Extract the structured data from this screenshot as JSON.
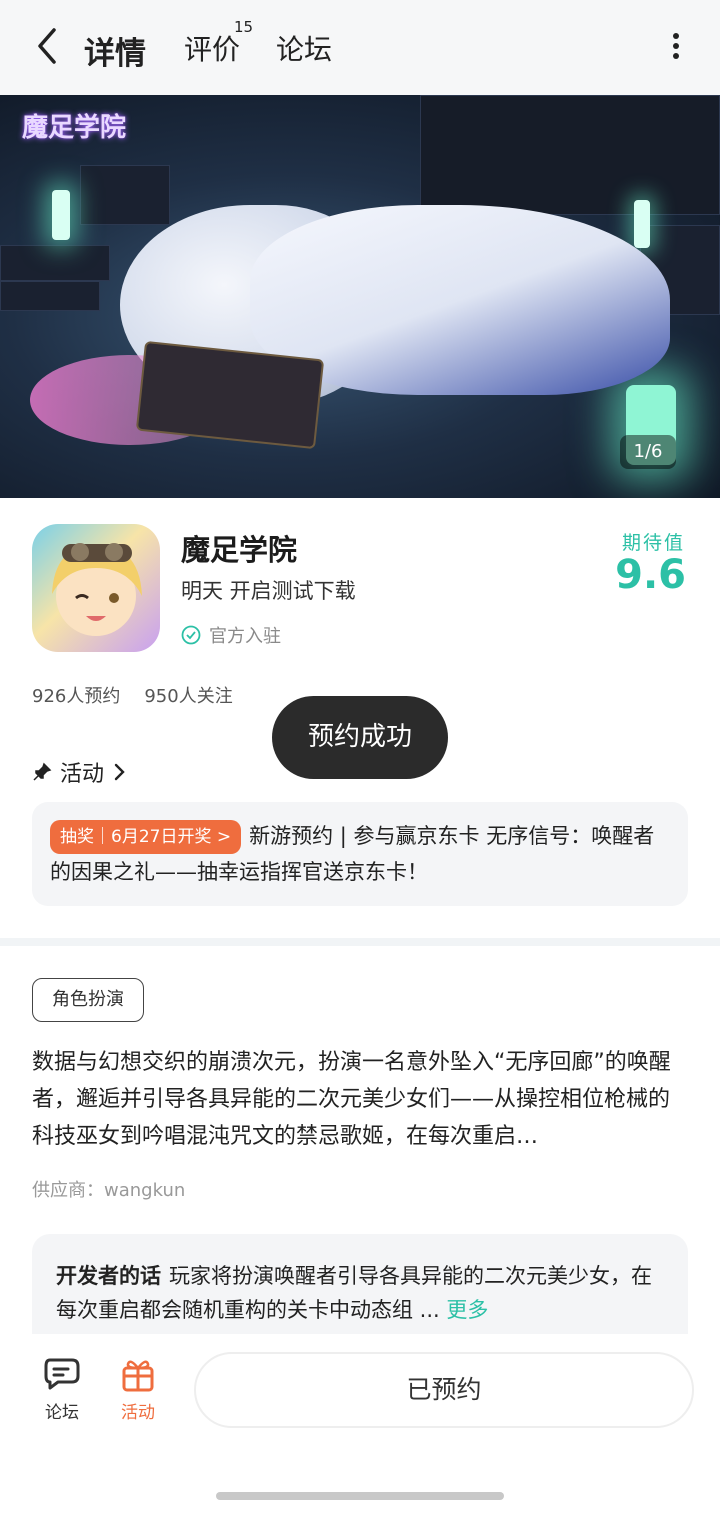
{
  "header": {
    "tabs": [
      {
        "label": "详情",
        "active": true
      },
      {
        "label": "评价",
        "badge": "15"
      },
      {
        "label": "论坛"
      }
    ],
    "back_icon": "chevron-left-icon",
    "more_icon": "vertical-dots-icon"
  },
  "banner": {
    "logo_text": "魔足学院",
    "counter": "1/6"
  },
  "game": {
    "name": "魔足学院",
    "status": "明天 开启测试下载",
    "official": "官方入驻",
    "score_label": "期待值",
    "score": "9.6",
    "reservations": "926人预约",
    "followers": "950人关注"
  },
  "toast": "预约成功",
  "activity": {
    "heading": "活动",
    "badge": "抽奖｜6月27日开奖 >",
    "text": "新游预约 | 参与赢京东卡 无序信号：唤醒者的因果之礼——抽幸运指挥官送京东卡！"
  },
  "tag": "角色扮演",
  "description": "数据与幻想交织的崩溃次元，扮演一名意外坠入“无序回廊”的唤醒者，邂逅并引导各具异能的二次元美少女们——从操控相位枪械的科技巫女到吟唱混沌咒文的禁忌歌姬，在每次重启…",
  "supplier": "供应商：wangkun",
  "developer_note": {
    "title": "开发者的话",
    "text": "玩家将扮演唤醒者引导各具异能的二次元美少女，在每次重启都会随机重构的关卡中动态组 ...",
    "more": "更多"
  },
  "bottom_bar": {
    "forum_label": "论坛",
    "activity_label": "活动",
    "reserve_button": "已预约"
  },
  "colors": {
    "accent": "#2cc0a6",
    "orange": "#ef6d3e"
  }
}
